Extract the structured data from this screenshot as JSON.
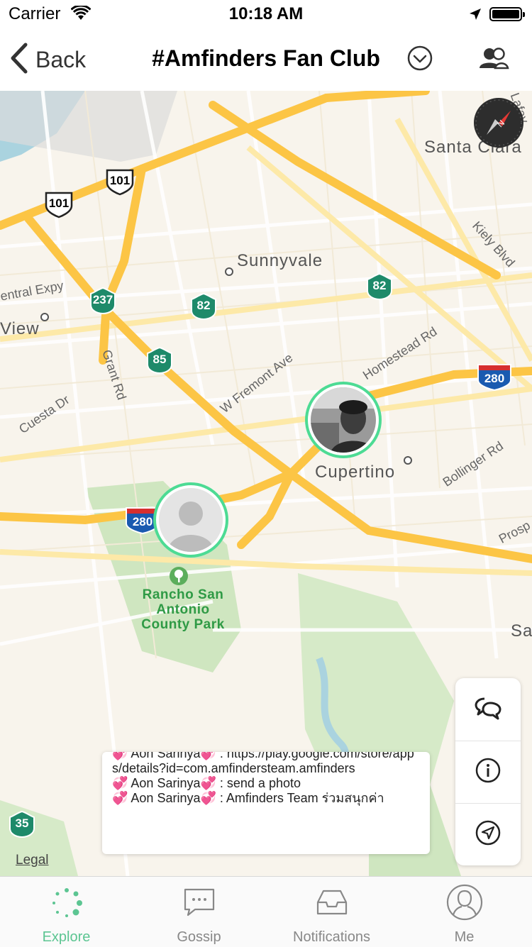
{
  "status_bar": {
    "carrier": "Carrier",
    "time": "10:18 AM"
  },
  "nav": {
    "back_label": "Back",
    "title": "#Amfinders Fan Club"
  },
  "map": {
    "cities": {
      "santa_clara": "Santa Clara",
      "sunnyvale": "Sunnyvale",
      "view": "View",
      "cupertino": "Cupertino",
      "sa": "Sa"
    },
    "roads": {
      "central_expy": "entral Expy",
      "grant_rd": "Grant Rd",
      "cuesta_dr": "Cuesta Dr",
      "w_fremont_ave": "W Fremont Ave",
      "homestead_rd": "Homestead Rd",
      "bollinger_rd": "Bollinger Rd",
      "kiely_blvd": "Kiely Blvd",
      "prosp": "Prosp",
      "lafay": "Lafay"
    },
    "shields": {
      "us101_a": "101",
      "us101_b": "101",
      "ca237": "237",
      "ca82_a": "82",
      "ca82_b": "82",
      "ca85": "85",
      "i280_a": "280",
      "i280_b": "280",
      "ca35": "35"
    },
    "park": {
      "line1": "Rancho San",
      "line2": "Antonio",
      "line3": "County Park"
    },
    "legal": "Legal"
  },
  "chat": {
    "lines": [
      "💞 Aon Sarinya💞 : https://play.google.com/store/apps/details?id=com.amfindersteam.amfinders",
      "💞 Aon Sarinya💞 : send a photo",
      "💞 Aon Sarinya💞 : Amfinders Team ร่วมสนุกค่า"
    ]
  },
  "tabs": [
    {
      "label": "Explore",
      "icon": "explore-icon",
      "active": true
    },
    {
      "label": "Gossip",
      "icon": "chat-bubble-icon",
      "active": false
    },
    {
      "label": "Notifications",
      "icon": "inbox-icon",
      "active": false
    },
    {
      "label": "Me",
      "icon": "profile-icon",
      "active": false
    }
  ],
  "colors": {
    "accent": "#5cc592",
    "avatar_ring": "#4ddb94",
    "highway": "#fcc545",
    "park": "#cfe6c0",
    "water": "#aad3df",
    "shield_green": "#1e8a6a",
    "interstate_blue": "#1a5ab0"
  }
}
